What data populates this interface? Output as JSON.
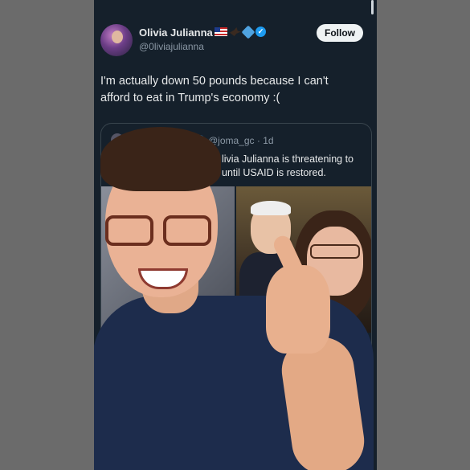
{
  "post": {
    "author_name": "Olivia Julianna",
    "author_handle": "@0liviajulianna",
    "follow_label": "Follow",
    "text": "I'm actually down 50 pounds because I can't afford to eat in Trump's economy :("
  },
  "quoted_post": {
    "handle_time": "@joma_gc · 1d",
    "text_line1": "livia Julianna is threatening to",
    "text_line2": "until USAID is restored."
  },
  "icons": [
    "us-flag-icon",
    "eagle-icon",
    "ballot-box-icon",
    "verified-badge-icon"
  ],
  "colors": {
    "background": "#15202b",
    "text": "#e7e9ea",
    "secondary": "#8b98a5",
    "verified": "#1d9bf0"
  }
}
